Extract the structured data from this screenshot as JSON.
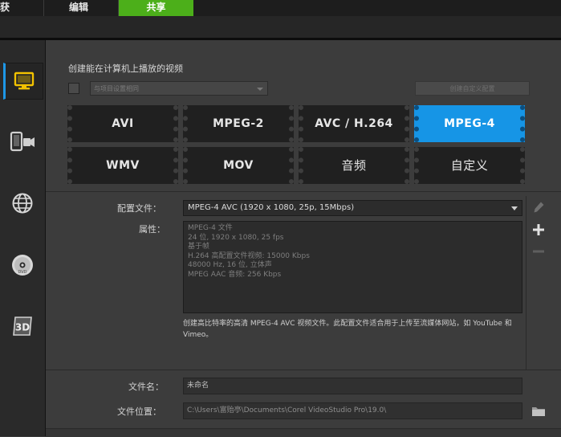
{
  "tabs": [
    {
      "label": "获",
      "active": false
    },
    {
      "label": "编辑",
      "active": false
    },
    {
      "label": "共享",
      "active": true
    }
  ],
  "colors": {
    "share_tab": "#4caf1a",
    "accent": "#1695e6"
  },
  "sidebar": {
    "items": [
      {
        "icon": "computer-icon",
        "selected": true
      },
      {
        "icon": "device-icon",
        "selected": false
      },
      {
        "icon": "globe-icon",
        "selected": false
      },
      {
        "icon": "disc-icon",
        "selected": false
      },
      {
        "icon": "3d-icon",
        "selected": false
      }
    ],
    "disc_label": "DVD",
    "three_d_label": "3D"
  },
  "main": {
    "title": "创建能在计算机上播放的视频",
    "project_select": "与项目设置相同",
    "create_profile_button": "创建自定义配置"
  },
  "formats": [
    {
      "label": "AVI",
      "selected": false
    },
    {
      "label": "MPEG-2",
      "selected": false
    },
    {
      "label": "AVC / H.264",
      "selected": false
    },
    {
      "label": "MPEG-4",
      "selected": true
    },
    {
      "label": "WMV",
      "selected": false
    },
    {
      "label": "MOV",
      "selected": false
    },
    {
      "label": "音频",
      "selected": false
    },
    {
      "label": "自定义",
      "selected": false
    }
  ],
  "profile": {
    "label": "配置文件：",
    "value": "MPEG-4 AVC (1920 x 1080, 25p, 15Mbps)"
  },
  "attributes": {
    "label": "属性：",
    "lines": [
      "MPEG-4 文件",
      "24 位, 1920 x 1080, 25 fps",
      "基于帧",
      "H.264 高配置文件视频: 15000 Kbps",
      "48000 Hz, 16 位, 立体声",
      "MPEG AAC 音频: 256 Kbps"
    ]
  },
  "description": "创建高比特率的高清 MPEG-4 AVC 视频文件。此配置文件适合用于上传至流媒体网站，如 YouTube 和 Vimeo。",
  "file": {
    "name_label": "文件名：",
    "name_value": "未命名",
    "location_label": "文件位置：",
    "location_value": "C:\\Users\\富贻亭\\Documents\\Corel VideoStudio Pro\\19.0\\"
  }
}
